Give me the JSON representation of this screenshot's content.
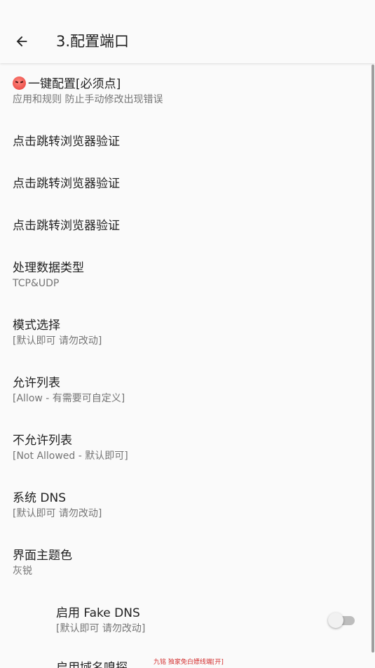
{
  "header": {
    "title": "3.配置端口"
  },
  "items": [
    {
      "title": "一键配置[必须点]",
      "subtitle": "应用和规则 防止手动修改出现错误",
      "icon": "angry-face-icon"
    },
    {
      "title": "点击跳转浏览器验证"
    },
    {
      "title": "点击跳转浏览器验证"
    },
    {
      "title": "点击跳转浏览器验证"
    },
    {
      "title": "处理数据类型",
      "subtitle": "TCP&UDP"
    },
    {
      "title": "模式选择",
      "subtitle": "[默认即可 请勿改动]"
    },
    {
      "title": "允许列表",
      "subtitle": "[Allow - 有需要可自定义]"
    },
    {
      "title": "不允许列表",
      "subtitle": "[Not Allowed - 默认即可]"
    },
    {
      "title": "系统 DNS",
      "subtitle": "[默认即可 请勿改动]"
    },
    {
      "title": "界面主题色",
      "subtitle": "灰锐"
    },
    {
      "title": "启用 Fake DNS",
      "subtitle": "[默认即可 请勿改动]",
      "switch_on": false
    },
    {
      "title": "启用域名嗅探"
    }
  ],
  "watermark": "九铭 独家免白嫖线端[开]"
}
